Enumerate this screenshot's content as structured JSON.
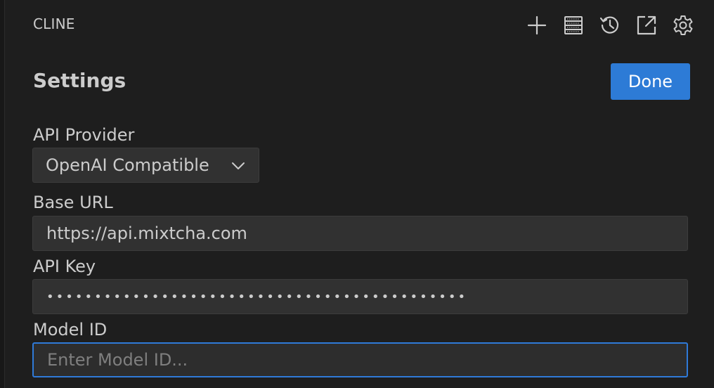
{
  "header": {
    "title": "CLINE",
    "actions": [
      {
        "icon": "plus-icon"
      },
      {
        "icon": "server-list-icon"
      },
      {
        "icon": "history-icon"
      },
      {
        "icon": "popout-icon"
      },
      {
        "icon": "gear-icon"
      }
    ]
  },
  "settings": {
    "title": "Settings",
    "done_label": "Done"
  },
  "form": {
    "api_provider": {
      "label": "API Provider",
      "value": "OpenAI Compatible"
    },
    "base_url": {
      "label": "Base URL",
      "value": "https://api.mixtcha.com"
    },
    "api_key": {
      "label": "API Key",
      "value": "••••••••••••••••••••••••••••••••••••••••••••"
    },
    "model_id": {
      "label": "Model ID",
      "value": "",
      "placeholder": "Enter Model ID..."
    }
  },
  "colors": {
    "background": "#1e1e1e",
    "input_background": "#313131",
    "accent": "#2d7bd6",
    "focus_border": "#2f7ad8",
    "text": "#cccccc"
  }
}
